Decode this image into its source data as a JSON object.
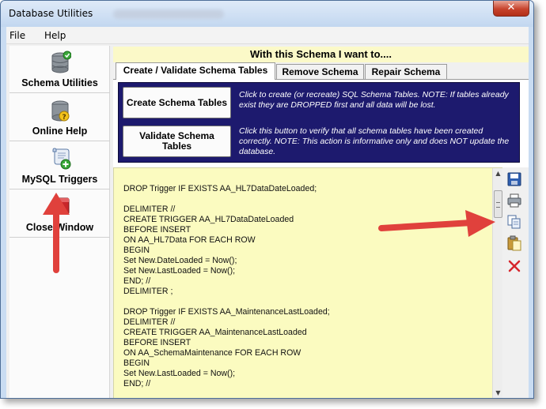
{
  "window": {
    "title": "Database Utilities",
    "close_glyph": "✕"
  },
  "menu": {
    "file": "File",
    "help": "Help"
  },
  "nav": {
    "items": [
      {
        "label": "Schema Utilities",
        "icon": "database-check-icon"
      },
      {
        "label": "Online Help",
        "icon": "database-help-icon"
      },
      {
        "label": "MySQL Triggers",
        "icon": "script-add-icon"
      },
      {
        "label": "Close Window",
        "icon": "close-window-icon"
      }
    ]
  },
  "main": {
    "header": "With this Schema I want to....",
    "tabs": [
      {
        "label": "Create / Validate Schema Tables",
        "active": true
      },
      {
        "label": "Remove Schema",
        "active": false
      },
      {
        "label": "Repair Schema",
        "active": false
      }
    ],
    "create_button": "Create Schema Tables",
    "create_note": "Click to create (or recreate) SQL Schema Tables. NOTE: If tables already exist they are DROPPED first and all data will be lost.",
    "validate_button": "Validate Schema Tables",
    "validate_note": "Click this button to verify that all schema tables have been created correctly. NOTE: This action is informative only and does NOT update the database."
  },
  "editor": {
    "code": "DROP Trigger IF EXISTS AA_HL7DataDateLoaded;\n\nDELIMITER //\nCREATE TRIGGER AA_HL7DataDateLoaded\nBEFORE INSERT\nON AA_HL7Data FOR EACH ROW\nBEGIN\nSet New.DateLoaded = Now();\nSet New.LastLoaded = Now();\nEND; //\nDELIMITER ;\n\nDROP Trigger IF EXISTS AA_MaintenanceLastLoaded;\nDELIMITER //\nCREATE TRIGGER AA_MaintenanceLastLoaded\nBEFORE INSERT\nON AA_SchemaMaintenance FOR EACH ROW\nBEGIN\nSet New.LastLoaded = Now();\nEND; //"
  },
  "toolbar": {
    "tools": [
      "save-icon",
      "print-icon",
      "copy-icon",
      "paste-icon",
      "delete-icon"
    ]
  },
  "colors": {
    "navy_panel": "#1d1a6e",
    "editor_bg": "#fbfbc0",
    "header_bg": "#fbf9c8",
    "annotation_arrow": "#e0413c"
  }
}
